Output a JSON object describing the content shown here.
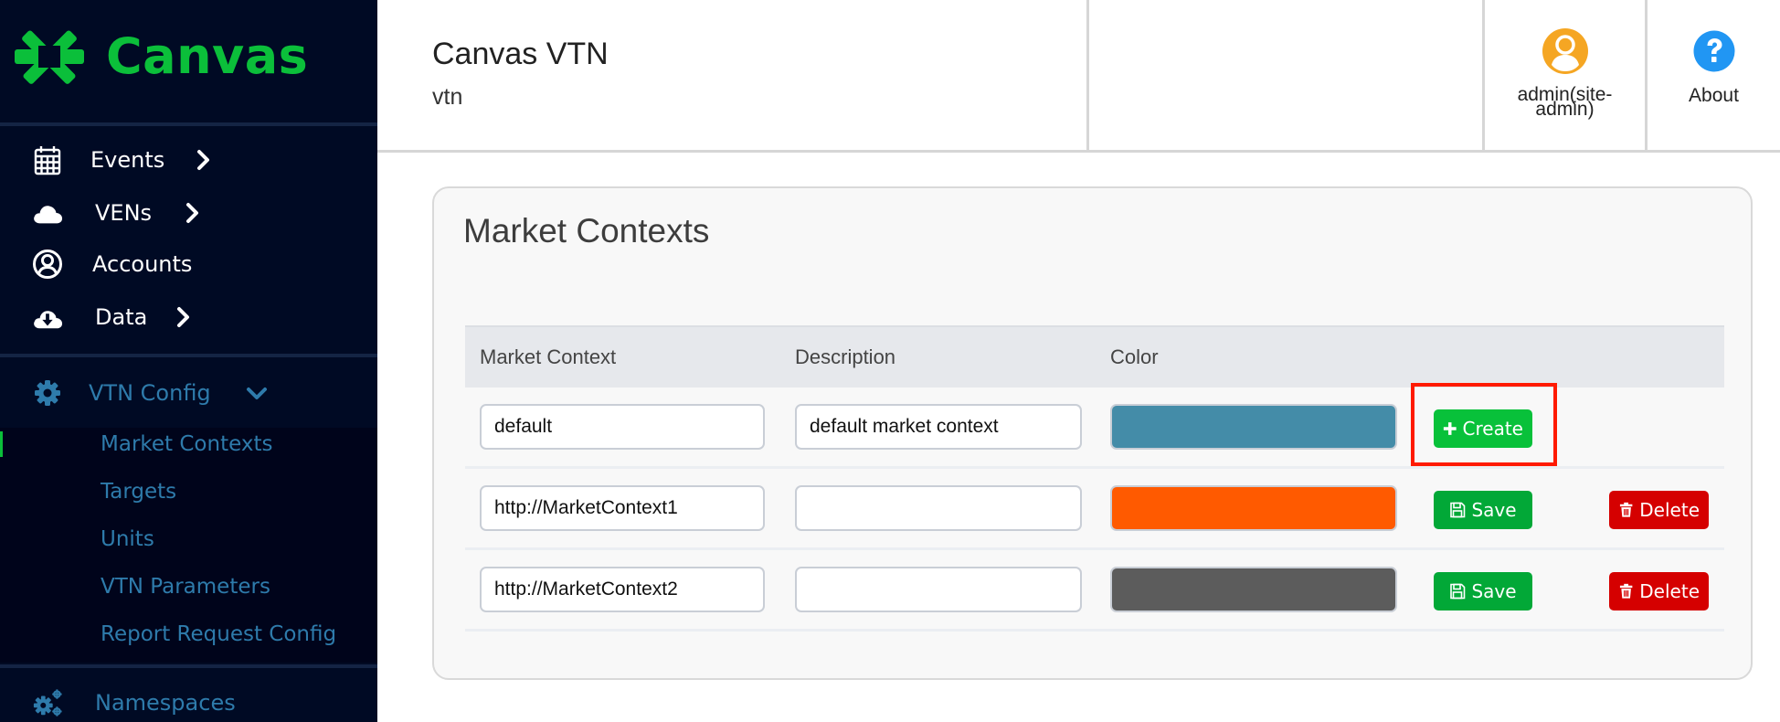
{
  "brand": {
    "name": "Canvas",
    "color": "#0bbf3a"
  },
  "sidebar": {
    "items": [
      {
        "label": "Events",
        "icon": "calendar-icon",
        "has_chevron": true
      },
      {
        "label": "VENs",
        "icon": "cloud-icon",
        "has_chevron": true
      },
      {
        "label": "Accounts",
        "icon": "user-circle-icon",
        "has_chevron": false
      },
      {
        "label": "Data",
        "icon": "cloud-download-icon",
        "has_chevron": true
      }
    ],
    "config": {
      "label": "VTN Config",
      "icon": "gear-icon",
      "expanded": true,
      "subitems": [
        {
          "label": "Market Contexts",
          "active": true
        },
        {
          "label": "Targets",
          "active": false
        },
        {
          "label": "Units",
          "active": false
        },
        {
          "label": "VTN Parameters",
          "active": false
        },
        {
          "label": "Report Request Config",
          "active": false
        }
      ]
    },
    "namespaces": {
      "label": "Namespaces",
      "icon": "gears-icon"
    }
  },
  "header": {
    "title": "Canvas VTN",
    "subtitle": "vtn",
    "user_label": "admin(site-admin)",
    "user_label_line1": "admin(site-",
    "user_label_line2": "admin)",
    "about_label": "About"
  },
  "card": {
    "title": "Market Contexts",
    "columns": [
      "Market Context",
      "Description",
      "Color"
    ],
    "rows": [
      {
        "market_context": "default",
        "description": "default market context",
        "color": "#448ca8",
        "actions": [
          "Create"
        ]
      },
      {
        "market_context": "http://MarketContext1",
        "description": "",
        "color": "#ff5a00",
        "actions": [
          "Save",
          "Delete"
        ]
      },
      {
        "market_context": "http://MarketContext2",
        "description": "",
        "color": "#5c5c5c",
        "actions": [
          "Save",
          "Delete"
        ]
      }
    ],
    "buttons": {
      "create": "Create",
      "save": "Save",
      "delete": "Delete"
    }
  },
  "colors": {
    "sidebar_bg": "#000a24",
    "sidebar_link": "#2e7bab",
    "create_green": "#08c13a",
    "save_green": "#02a837",
    "delete_red": "#d50000",
    "user_avatar": "#f5a623",
    "about_icon": "#2196f3",
    "highlight": "#ff1a00"
  }
}
